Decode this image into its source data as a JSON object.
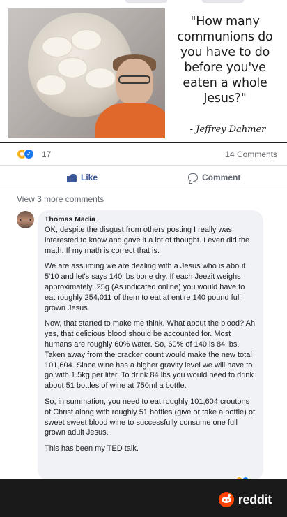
{
  "meme": {
    "quote": "\"How many communions do you have to do before you've eaten a whole Jesus?\"",
    "signature": "- Jeffrey Dahmer"
  },
  "post": {
    "reaction_count": "17",
    "comment_count": "14 Comments",
    "like_label": "Like",
    "comment_label": "Comment",
    "view_more": "View 3 more comments"
  },
  "comment": {
    "author": "Thomas Madia",
    "paragraphs": [
      "OK, despite the disgust from others posting I really was interested to know and gave it a lot of thought. I even did the math. If my math is correct that is.",
      "We are assuming we are dealing with a Jesus who is about 5'10 and let's says 140 lbs bone dry. If each Jeezit weighs approximately .25g (As indicated online) you would have to eat roughly 254,011 of them to eat at entire 140 pound full grown Jesus.",
      "Now, that started to make me think. What about the blood? Ah yes, that delicious blood should be accounted for. Most humans are roughly 60% water. So, 60% of 140 is 84 lbs. Taken away from the cracker count would make the new total 101,604. Since wine has a higher gravity level we will have to go with 1.5kg per liter. To drink 84 lbs you would need to drink about 51 bottles of wine at 750ml a bottle.",
      "So, in summation, you need to eat roughly 101,604 croutons of Christ along with roughly 51 bottles (give or take a bottle) of sweet sweet blood wine to successfully consume one full grown adult Jesus.",
      "This has been my TED talk."
    ]
  },
  "footer": {
    "brand": "reddit"
  },
  "colors": {
    "like_blue": "#3b5998",
    "reddit_orange": "#ff4500",
    "bubble_bg": "#f0f2f5"
  }
}
